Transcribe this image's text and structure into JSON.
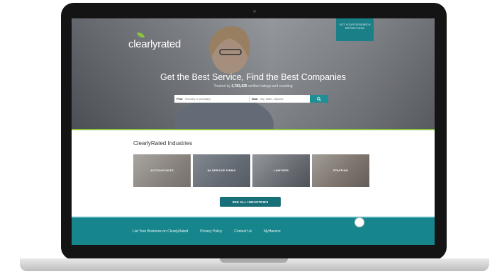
{
  "site": {
    "logo_text": "clearlyrated",
    "notice_text": "GET YOUR RESEARCH REPORT NOW"
  },
  "hero": {
    "title": "Get the Best Service, Find the Best Companies",
    "subtitle_prefix": "Trusted by",
    "subtitle_count": "2,783,425",
    "subtitle_suffix": "verified ratings and counting",
    "search": {
      "find_label": "Find",
      "find_placeholder": "Industry or company",
      "near_label": "Near",
      "near_placeholder": "city, state, zipcode"
    }
  },
  "industries": {
    "title": "ClearlyRated Industries",
    "tiles": [
      {
        "label": "ACCOUNTANTS"
      },
      {
        "label": "IM SERVICE FIRMS"
      },
      {
        "label": "LAWYERS"
      },
      {
        "label": "STAFFING"
      }
    ],
    "see_all_label": "SEE ALL INDUSTRIES"
  },
  "footer": {
    "links": [
      "List Your Business on ClearlyRated",
      "Privacy Policy",
      "Contact Us",
      "MyHavens"
    ]
  },
  "colors": {
    "teal": "#17858c",
    "dark_teal": "#176f78",
    "accent_green": "#8cc63f"
  }
}
